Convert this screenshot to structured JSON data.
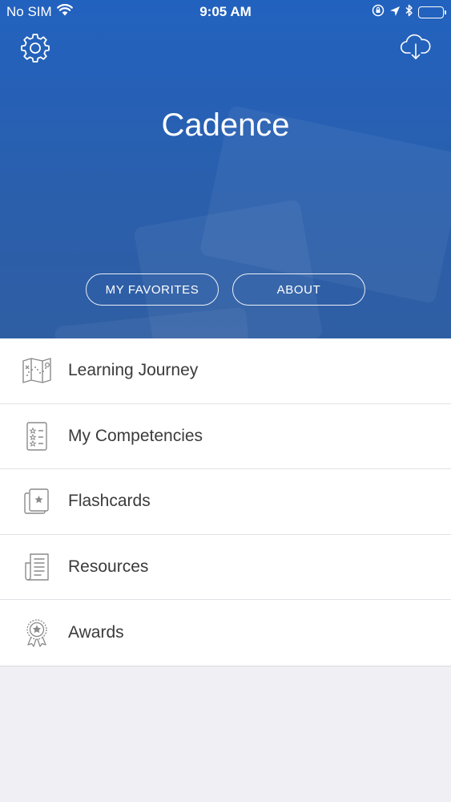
{
  "status_bar": {
    "carrier": "No SIM",
    "time": "9:05 AM"
  },
  "header": {
    "title": "Cadence",
    "favorites_label": "MY FAVORITES",
    "about_label": "ABOUT"
  },
  "menu": {
    "items": [
      {
        "label": "Learning Journey",
        "icon": "map-icon"
      },
      {
        "label": "My Competencies",
        "icon": "checklist-icon"
      },
      {
        "label": "Flashcards",
        "icon": "flashcards-icon"
      },
      {
        "label": "Resources",
        "icon": "document-icon"
      },
      {
        "label": "Awards",
        "icon": "award-icon"
      }
    ]
  },
  "colors": {
    "header_blue": "#2262bf",
    "background": "#efeff4",
    "text": "#3b3b3b",
    "icon_gray": "#8a8a8a"
  }
}
